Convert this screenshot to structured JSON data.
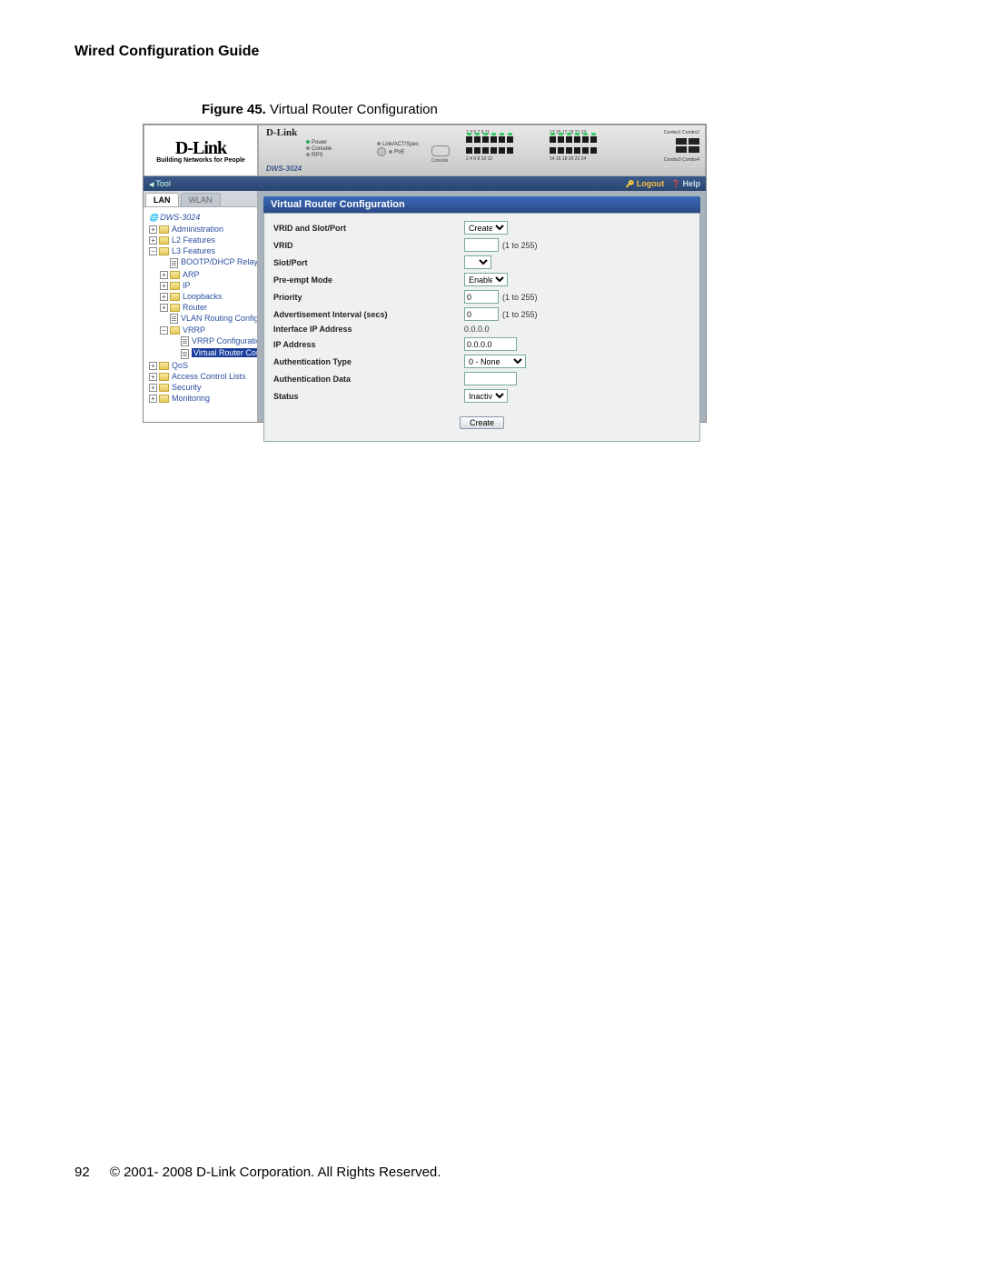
{
  "doc": {
    "header": "Wired Configuration Guide",
    "figure_label": "Figure 45.",
    "figure_title": "Virtual Router Configuration",
    "page_number": "92",
    "copyright": "© 2001- 2008 D-Link Corporation. All Rights Reserved."
  },
  "branding": {
    "logo": "D-Link",
    "tagline": "Building Networks for People",
    "device_logo": "D-Link",
    "model": "DWS-3024"
  },
  "device_leds": {
    "power": "Power",
    "console": "Console",
    "rps": "RPS",
    "linkact": "Link/ACT/Spec",
    "poe": "PoE",
    "console_port": "Console",
    "combo1": "Combo1 Combo2",
    "combo2": "Combo3 Combo4",
    "ports_top_a": "1  3  5  7  9  11",
    "ports_top_b": "13  15  17  19  21  23",
    "ports_bot_a": "2  4  6  8  10  12",
    "ports_bot_b": "14  16  18  20  22  24"
  },
  "toolbar": {
    "tool": "Tool",
    "logout": "Logout",
    "help": "Help"
  },
  "tabs": {
    "lan": "LAN",
    "wlan": "WLAN"
  },
  "tree": {
    "root": "DWS-3024",
    "administration": "Administration",
    "l2": "L2 Features",
    "l3": "L3 Features",
    "bootp": "BOOTP/DHCP Relay Agent",
    "arp": "ARP",
    "ip": "IP",
    "loopbacks": "Loopbacks",
    "router": "Router",
    "vlan_routing": "VLAN Routing Configurati",
    "vrrp": "VRRP",
    "vrrp_config": "VRRP Configuration",
    "virtual_router_config": "Virtual Router Configu",
    "qos": "QoS",
    "acl": "Access Control Lists",
    "security": "Security",
    "monitoring": "Monitoring"
  },
  "panel": {
    "title": "Virtual Router Configuration",
    "button": "Create",
    "fields": {
      "vrid_slotport_label": "VRID and Slot/Port",
      "vrid_slotport_value": "Create",
      "vrid_label": "VRID",
      "vrid_value": "",
      "vrid_hint": "(1 to 255)",
      "slotport_label": "Slot/Port",
      "slotport_value": "",
      "preempt_label": "Pre-empt Mode",
      "preempt_value": "Enable",
      "priority_label": "Priority",
      "priority_value": "0",
      "priority_hint": "(1 to 255)",
      "adv_label": "Advertisement Interval (secs)",
      "adv_value": "0",
      "adv_hint": "(1 to 255)",
      "ifip_label": "Interface IP Address",
      "ifip_value": "0.0.0.0",
      "ipaddr_label": "IP Address",
      "ipaddr_value": "0.0.0.0",
      "authtype_label": "Authentication Type",
      "authtype_value": "0 - None",
      "authdata_label": "Authentication Data",
      "authdata_value": "",
      "status_label": "Status",
      "status_value": "Inactive"
    }
  }
}
